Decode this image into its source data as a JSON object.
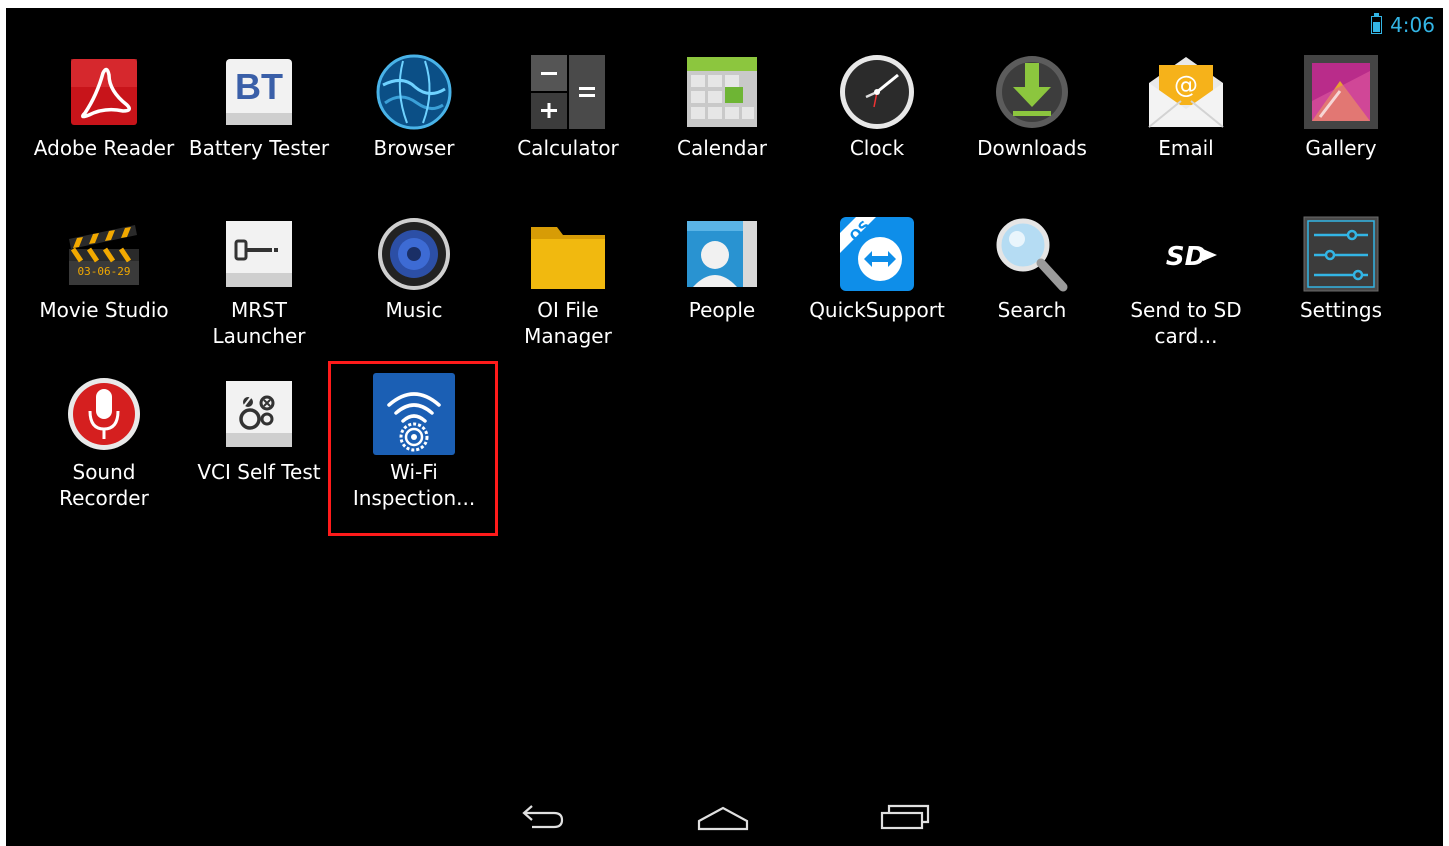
{
  "status_bar": {
    "time": "4:06",
    "battery_level": 0.7,
    "battery_icon": "battery-charging-icon"
  },
  "apps": [
    {
      "label": "Adobe Reader",
      "icon": "adobe-reader-icon"
    },
    {
      "label": "Battery Tester",
      "icon": "battery-tester-icon"
    },
    {
      "label": "Browser",
      "icon": "browser-globe-icon"
    },
    {
      "label": "Calculator",
      "icon": "calculator-icon"
    },
    {
      "label": "Calendar",
      "icon": "calendar-icon"
    },
    {
      "label": "Clock",
      "icon": "clock-icon"
    },
    {
      "label": "Downloads",
      "icon": "downloads-icon"
    },
    {
      "label": "Email",
      "icon": "email-icon"
    },
    {
      "label": "Gallery",
      "icon": "gallery-icon"
    },
    {
      "label": "Movie Studio",
      "icon": "movie-studio-icon"
    },
    {
      "label": "MRST Launcher",
      "icon": "mrst-launcher-icon"
    },
    {
      "label": "Music",
      "icon": "music-speaker-icon"
    },
    {
      "label": "OI File Manager",
      "icon": "folder-icon"
    },
    {
      "label": "People",
      "icon": "people-contacts-icon"
    },
    {
      "label": "QuickSupport",
      "icon": "quicksupport-icon"
    },
    {
      "label": "Search",
      "icon": "search-magnifier-icon"
    },
    {
      "label": "Send to SD card...",
      "icon": "sd-card-icon"
    },
    {
      "label": "Settings",
      "icon": "settings-sliders-icon"
    },
    {
      "label": "Sound Recorder",
      "icon": "sound-recorder-icon"
    },
    {
      "label": "VCI Self Test",
      "icon": "vci-self-test-icon"
    },
    {
      "label": "Wi-Fi Inspection...",
      "icon": "wifi-inspection-icon"
    }
  ],
  "navbar": {
    "back_icon": "back-icon",
    "home_icon": "home-icon",
    "recents_icon": "recent-apps-icon"
  },
  "colors": {
    "status_accent": "#33b5e5",
    "highlight": "#ff1b1b",
    "background": "#000000"
  }
}
